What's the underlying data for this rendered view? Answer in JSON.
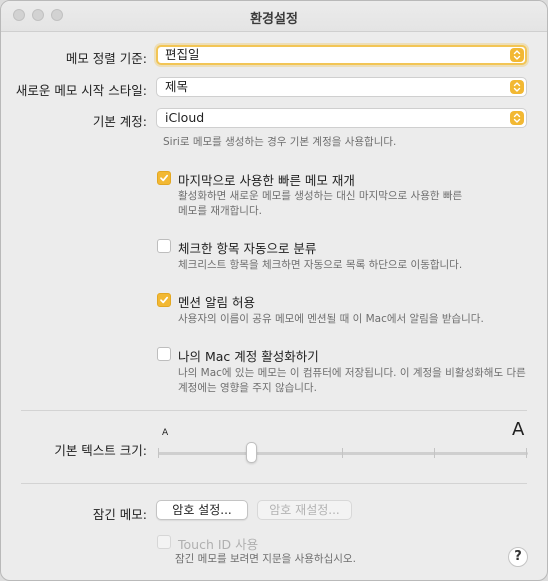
{
  "window": {
    "title": "환경설정"
  },
  "settings": {
    "sort_label": "메모 정렬 기준:",
    "sort_value": "편집일",
    "new_note_label": "새로운 메모 시작 스타일:",
    "new_note_value": "제목",
    "account_label": "기본 계정:",
    "account_value": "iCloud",
    "account_hint": "Siri로 메모를 생성하는 경우 기본 계정을 사용합니다."
  },
  "options": [
    {
      "label": "마지막으로 사용한 빠른 메모 재개",
      "checked": true,
      "desc1": "활성화하면 새로운 메모를 생성하는 대신 마지막으로 사용한 빠른",
      "desc2": "메모를 재개합니다."
    },
    {
      "label": "체크한 항목 자동으로 분류",
      "checked": false,
      "desc1": "체크리스트 항목을 체크하면 자동으로 목록 하단으로 이동합니다."
    },
    {
      "label": "멘션 알림 허용",
      "checked": true,
      "desc1": "사용자의 이름이 공유 메모에 멘션될 때 이 Mac에서 알림을 받습니다."
    },
    {
      "label": "나의 Mac 계정 활성화하기",
      "checked": false,
      "desc1": "나의 Mac에 있는 메모는 이 컴퓨터에 저장됩니다. 이 계정을 비활성화해도 다른",
      "desc2": "계정에는 영향을 주지 않습니다."
    }
  ],
  "text_size": {
    "label": "기본 텍스트 크기:",
    "small_glyph": "A",
    "large_glyph": "A",
    "level_fraction": 0.25
  },
  "locked": {
    "label": "잠긴 메모:",
    "set_password": "암호 설정...",
    "reset_password": "암호 재설정...",
    "touch_id": "Touch ID 사용",
    "hint": "잠긴 메모를 보려면 지문을 사용하십시오."
  },
  "help": "?",
  "colors": {
    "accent": "#f2b833",
    "focus_ring": "#f2c555"
  }
}
